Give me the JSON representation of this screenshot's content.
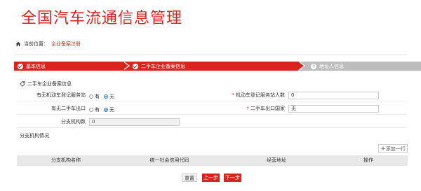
{
  "header": {
    "title": "全国汽车流通信息管理"
  },
  "breadcrumb": {
    "prefix": "当前位置：",
    "current": "企业备案注册"
  },
  "steps": [
    {
      "label": "基本信息",
      "state": "done"
    },
    {
      "label": "二手车企业备案信息",
      "state": "active"
    },
    {
      "label": "3",
      "text": "地址人信息",
      "state": "pending"
    }
  ],
  "section": {
    "title": "二手车企业备案信息"
  },
  "form": {
    "q1": {
      "label": "有无机动车登记服务站",
      "opt_yes": "有",
      "opt_no": "无",
      "selected": "无"
    },
    "q2": {
      "label": "机动车登记服务站人数",
      "value": "0"
    },
    "q3": {
      "label": "有无二手车出口",
      "opt_yes": "有",
      "opt_no": "无",
      "selected": "无"
    },
    "q4": {
      "label": "二手车出口国家",
      "value": "无"
    },
    "q5": {
      "label": "分支机构数",
      "value": "0"
    }
  },
  "branches": {
    "title": "分支机构情况",
    "add_label": "添加一行",
    "columns": [
      "分支机构名称",
      "统一社会信用代码",
      "经营地址",
      "操作"
    ]
  },
  "buttons": {
    "reset": "重置",
    "prev": "上一步",
    "next": "下一步"
  },
  "colors": {
    "accent": "#d9251d",
    "pending": "#bdbdbd",
    "radio": "#1a73e8"
  }
}
